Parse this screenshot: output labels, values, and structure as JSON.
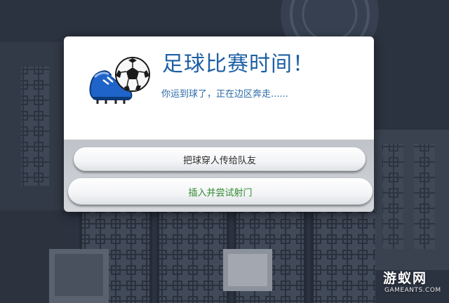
{
  "dialog": {
    "title": "足球比赛时间！",
    "description": "你运到球了，正在边区奔走......",
    "icon": "soccer-cleat-and-ball-icon",
    "accent_color": "#1d5fa5",
    "choices": [
      {
        "label": "把球穿人传给队友",
        "color": "#2b2b2b"
      },
      {
        "label": "插入并尝试射门",
        "color": "#2f8a2f"
      }
    ]
  },
  "watermark": {
    "logo": "游蚁网",
    "sub": "GAMEANTS.COM"
  }
}
